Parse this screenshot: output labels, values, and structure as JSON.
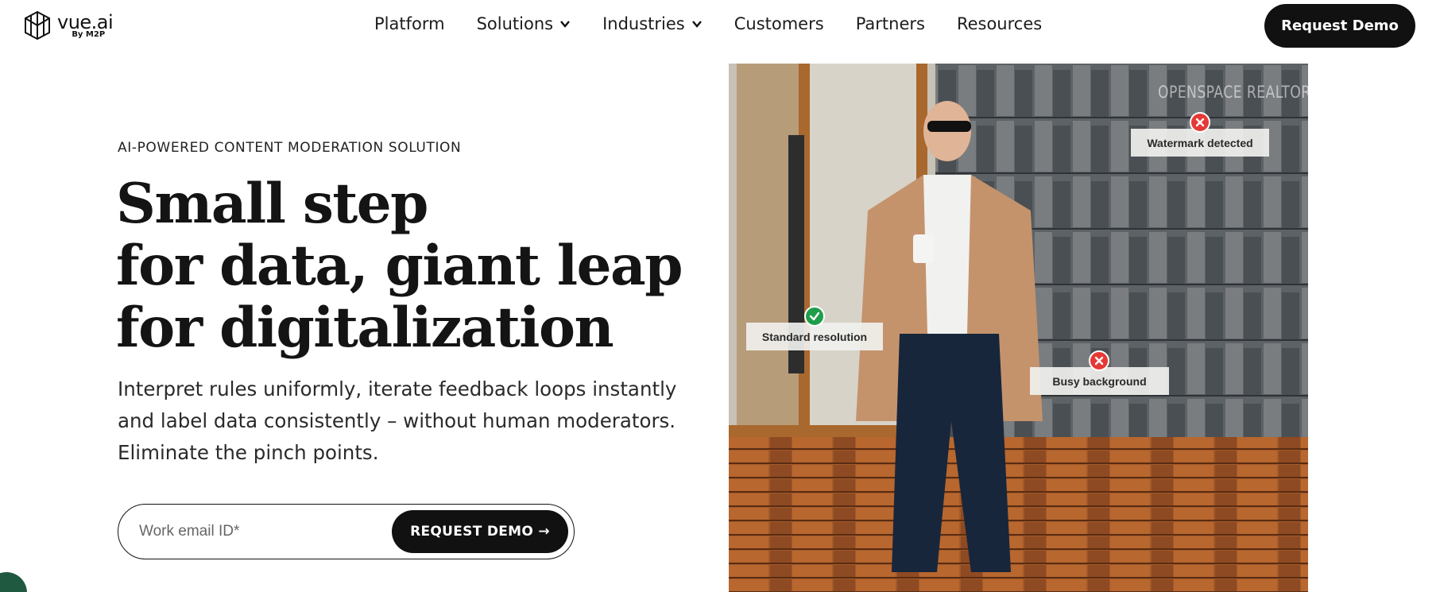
{
  "brand": {
    "name": "vue.ai",
    "sub": "By M2P"
  },
  "nav": {
    "items": [
      {
        "label": "Platform",
        "has_dropdown": false
      },
      {
        "label": "Solutions",
        "has_dropdown": true
      },
      {
        "label": "Industries",
        "has_dropdown": true
      },
      {
        "label": "Customers",
        "has_dropdown": false
      },
      {
        "label": "Partners",
        "has_dropdown": false
      },
      {
        "label": "Resources",
        "has_dropdown": false
      }
    ],
    "cta_label": "Request Demo"
  },
  "hero": {
    "eyebrow": "AI-POWERED CONTENT MODERATION SOLUTION",
    "headline": [
      "Small step",
      "for data, giant leap",
      "for digitalization"
    ],
    "subtext": [
      "Interpret rules uniformly, iterate feedback loops instantly",
      "and label data consistently – without human moderators.",
      "Eliminate the pinch points."
    ],
    "email_placeholder": "Work email ID*",
    "email_value": "",
    "submit_label": "REQUEST DEMO →"
  },
  "image": {
    "watermark_text": "OPENSPACE REALTORS",
    "annotations": [
      {
        "label": "Watermark detected",
        "status": "fail"
      },
      {
        "label": "Standard resolution",
        "status": "pass"
      },
      {
        "label": "Busy background",
        "status": "fail"
      }
    ]
  },
  "colors": {
    "primary": "#111111",
    "pass": "#1e9e4a",
    "fail": "#e53935",
    "chat": "#1f5a40"
  }
}
